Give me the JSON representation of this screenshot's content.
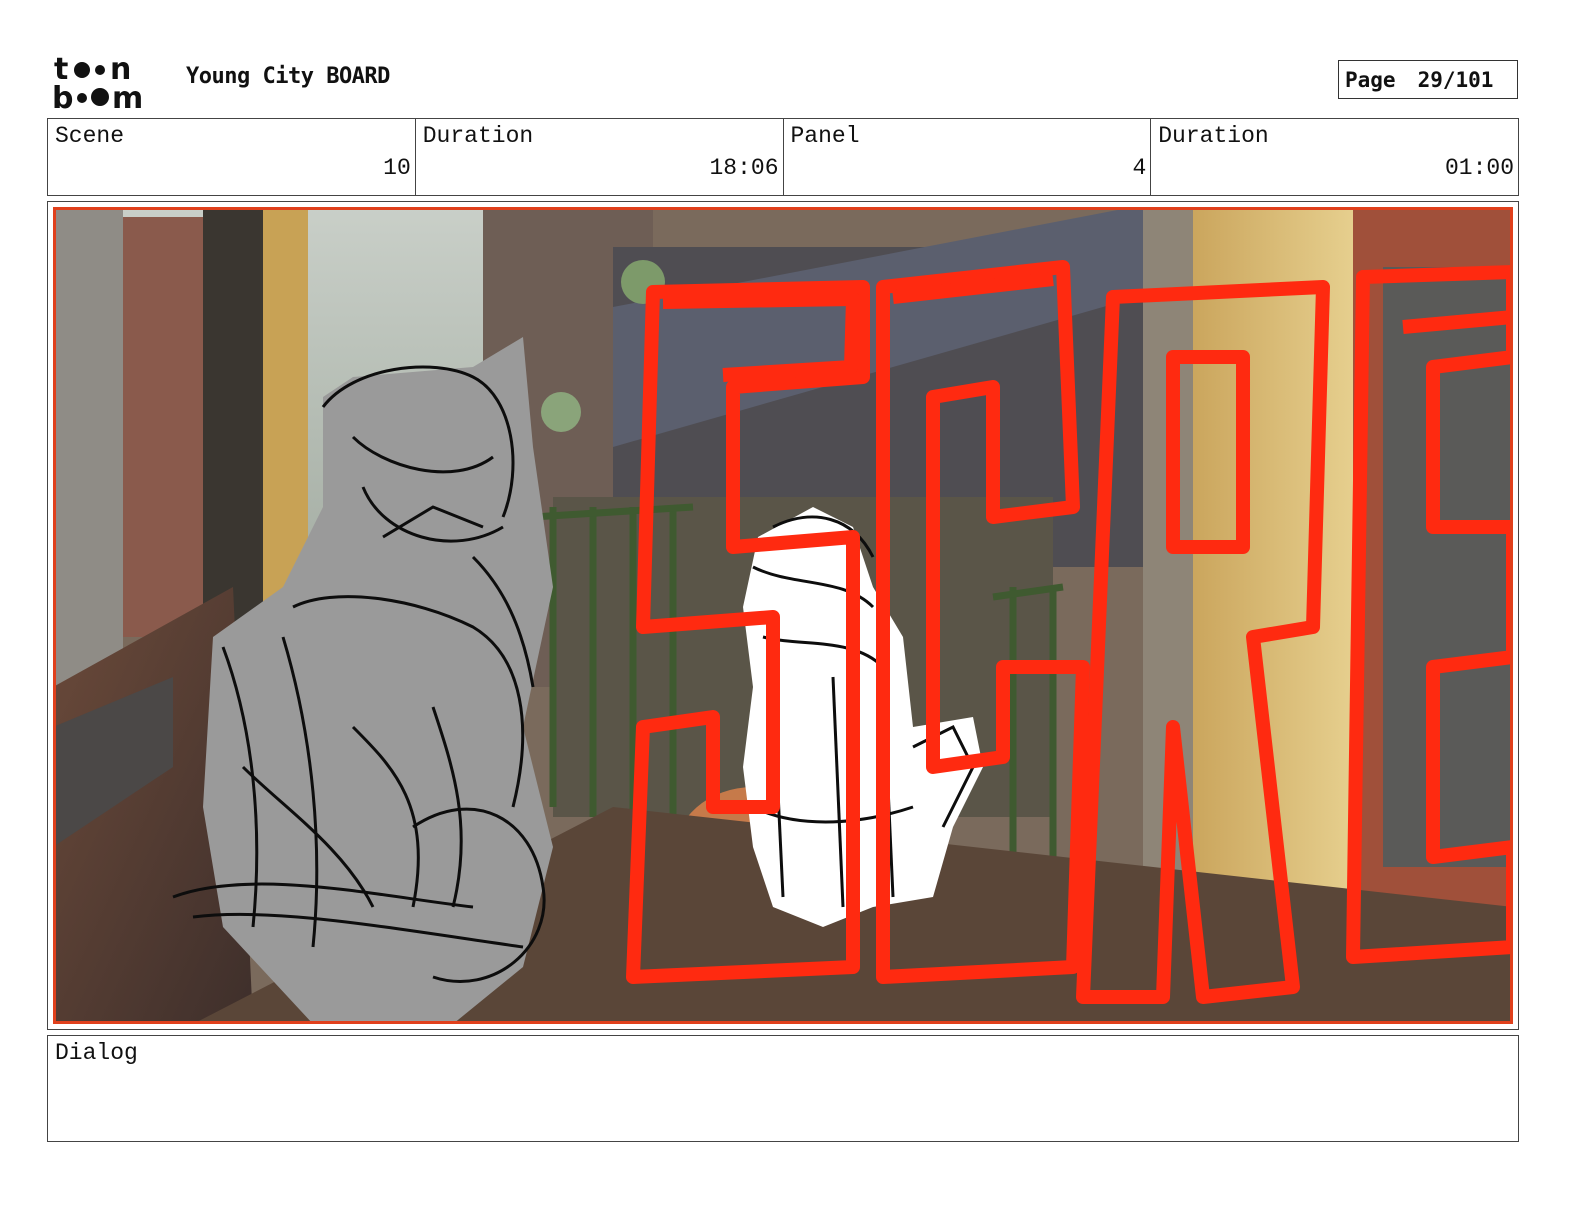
{
  "header": {
    "logo_text": "toon boom",
    "title": "Young City BOARD",
    "page_label": "Page",
    "page_value": "29/101"
  },
  "info": {
    "scene_label": "Scene",
    "scene_value": "10",
    "scene_duration_label": "Duration",
    "scene_duration_value": "18:06",
    "panel_label": "Panel",
    "panel_value": "4",
    "panel_duration_label": "Duration",
    "panel_duration_value": "01:00"
  },
  "panel": {
    "frame_color": "#e0401c",
    "sketch_text_color": "#ff2a10"
  },
  "dialog": {
    "label": "Dialog",
    "text": ""
  }
}
